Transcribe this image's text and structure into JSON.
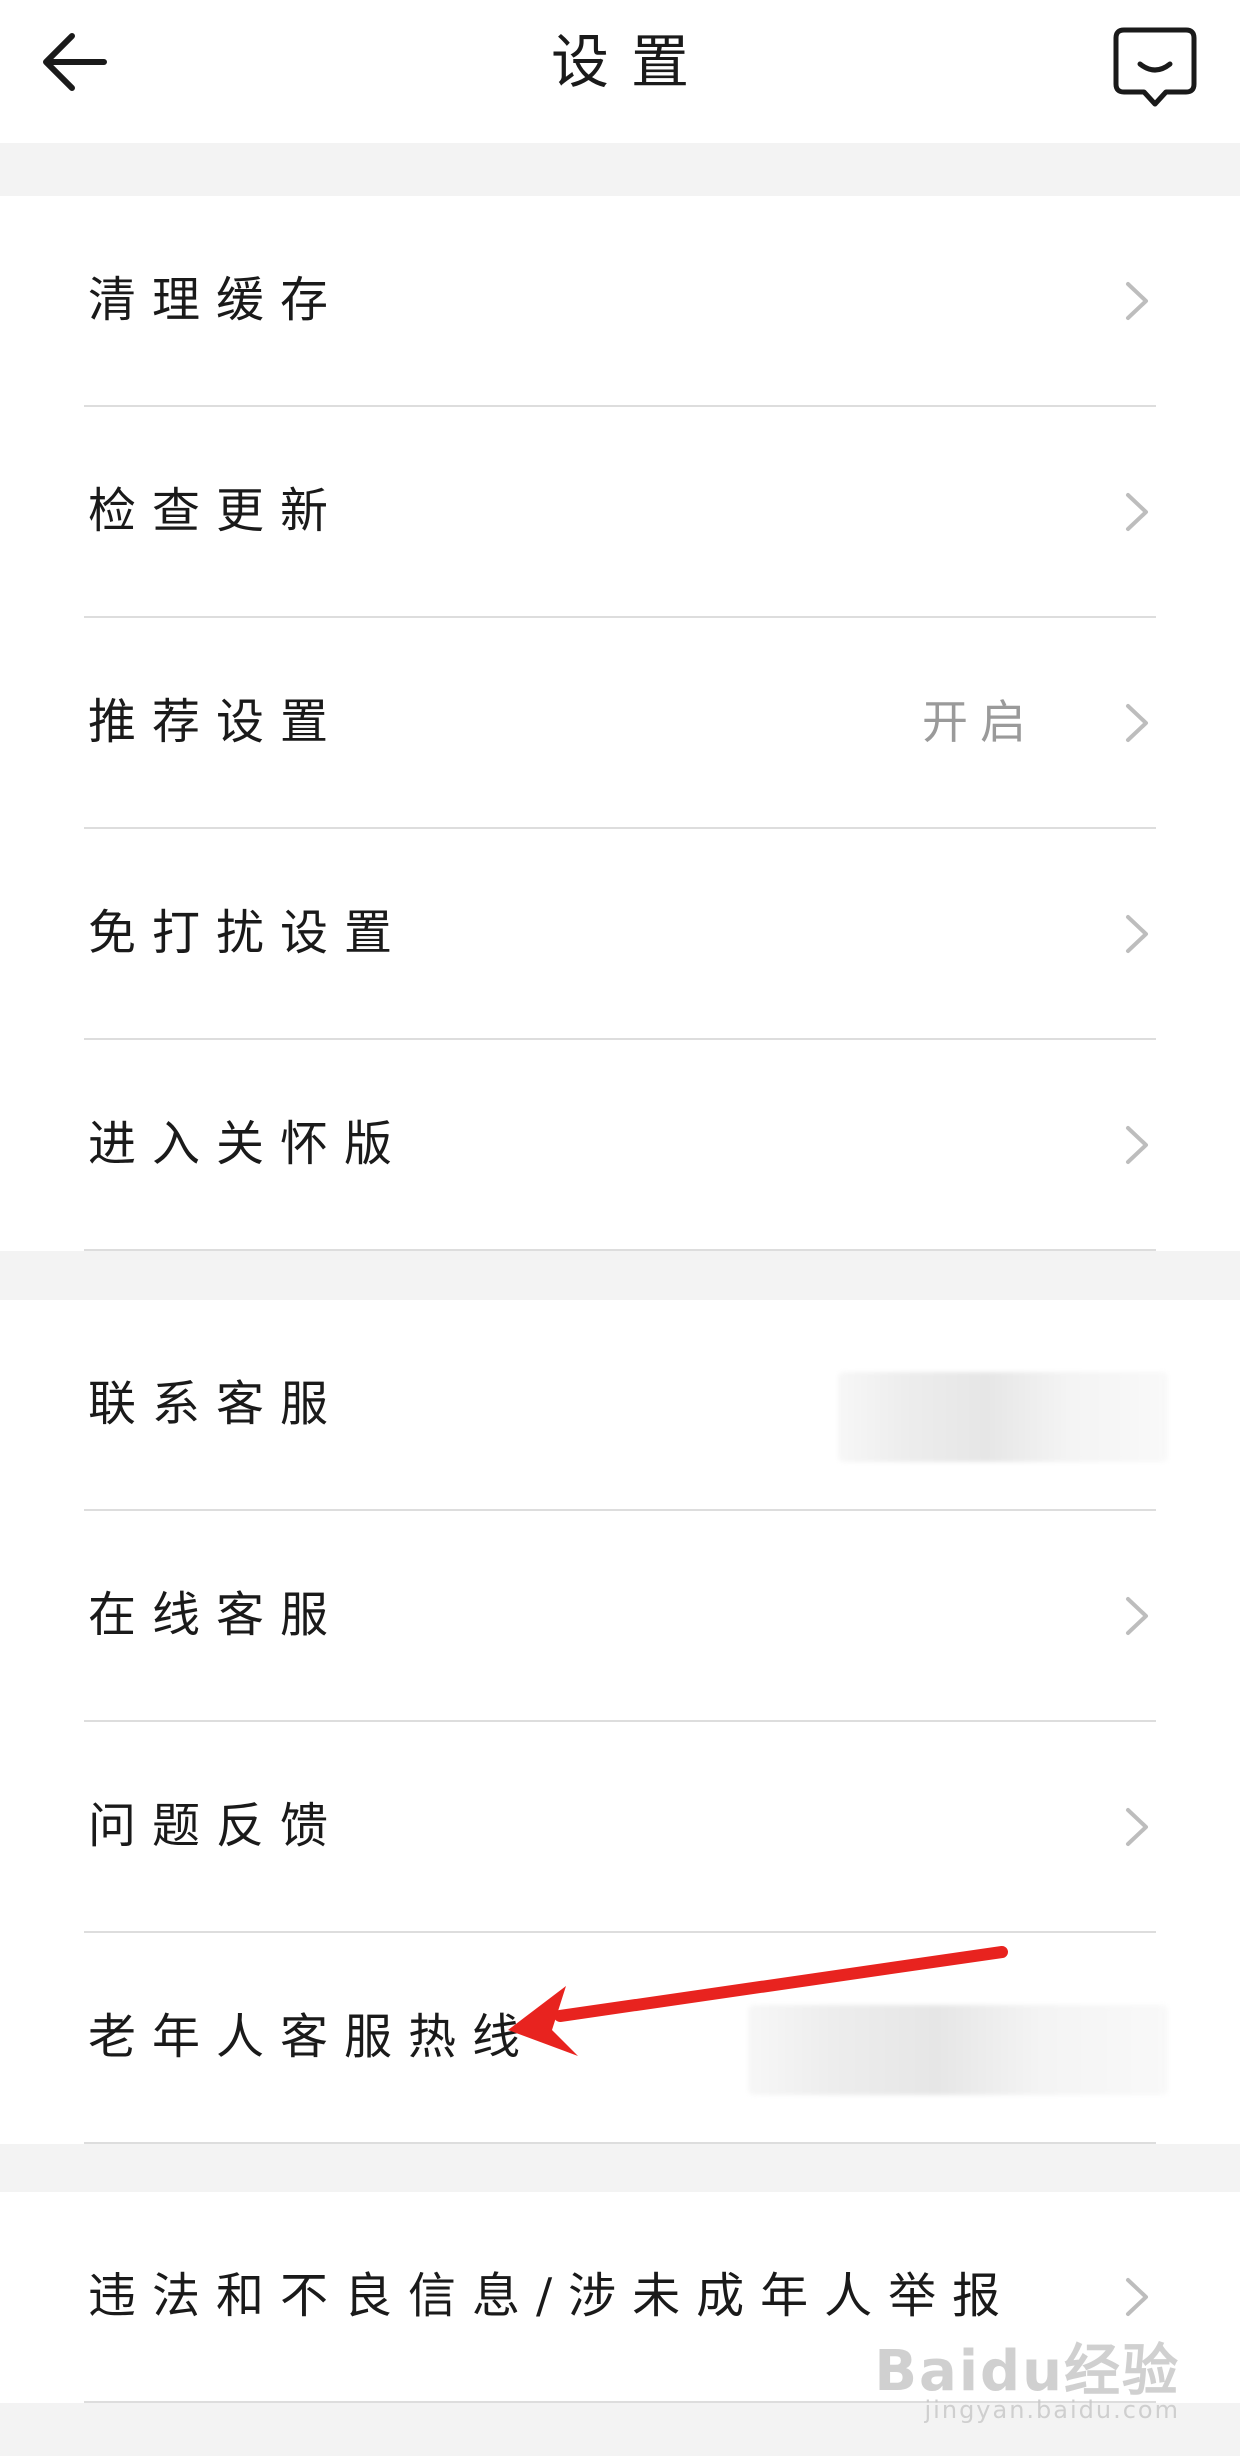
{
  "header": {
    "title": "设置",
    "back_icon": "arrow-left-icon",
    "service_icon": "customer-service-icon"
  },
  "groups": [
    {
      "items": [
        {
          "label": "清理缓存",
          "value": "",
          "chevron": true
        },
        {
          "label": "检查更新",
          "value": "",
          "chevron": true
        },
        {
          "label": "推荐设置",
          "value": "开启",
          "chevron": true
        },
        {
          "label": "免打扰设置",
          "value": "",
          "chevron": true
        },
        {
          "label": "进入关怀版",
          "value": "",
          "chevron": true
        }
      ]
    },
    {
      "items": [
        {
          "label": "联系客服",
          "value": "",
          "chevron": false,
          "blurred": true
        },
        {
          "label": "在线客服",
          "value": "",
          "chevron": true
        },
        {
          "label": "问题反馈",
          "value": "",
          "chevron": true
        },
        {
          "label": "老年人客服热线",
          "value": "",
          "chevron": false,
          "blurred": true
        }
      ]
    },
    {
      "items": [
        {
          "label": "违法和不良信息/涉未成年人举报",
          "value": "",
          "chevron": true
        }
      ]
    }
  ],
  "annotation": {
    "color": "#e8231f",
    "icon": "red-arrow-annotation"
  },
  "watermark": {
    "main": "Baidu经验",
    "sub": "jingyan.baidu.com"
  },
  "colors": {
    "background": "#f3f3f3",
    "card": "#ffffff",
    "divider": "#dddddd",
    "secondary_text": "#9a9a9a"
  }
}
